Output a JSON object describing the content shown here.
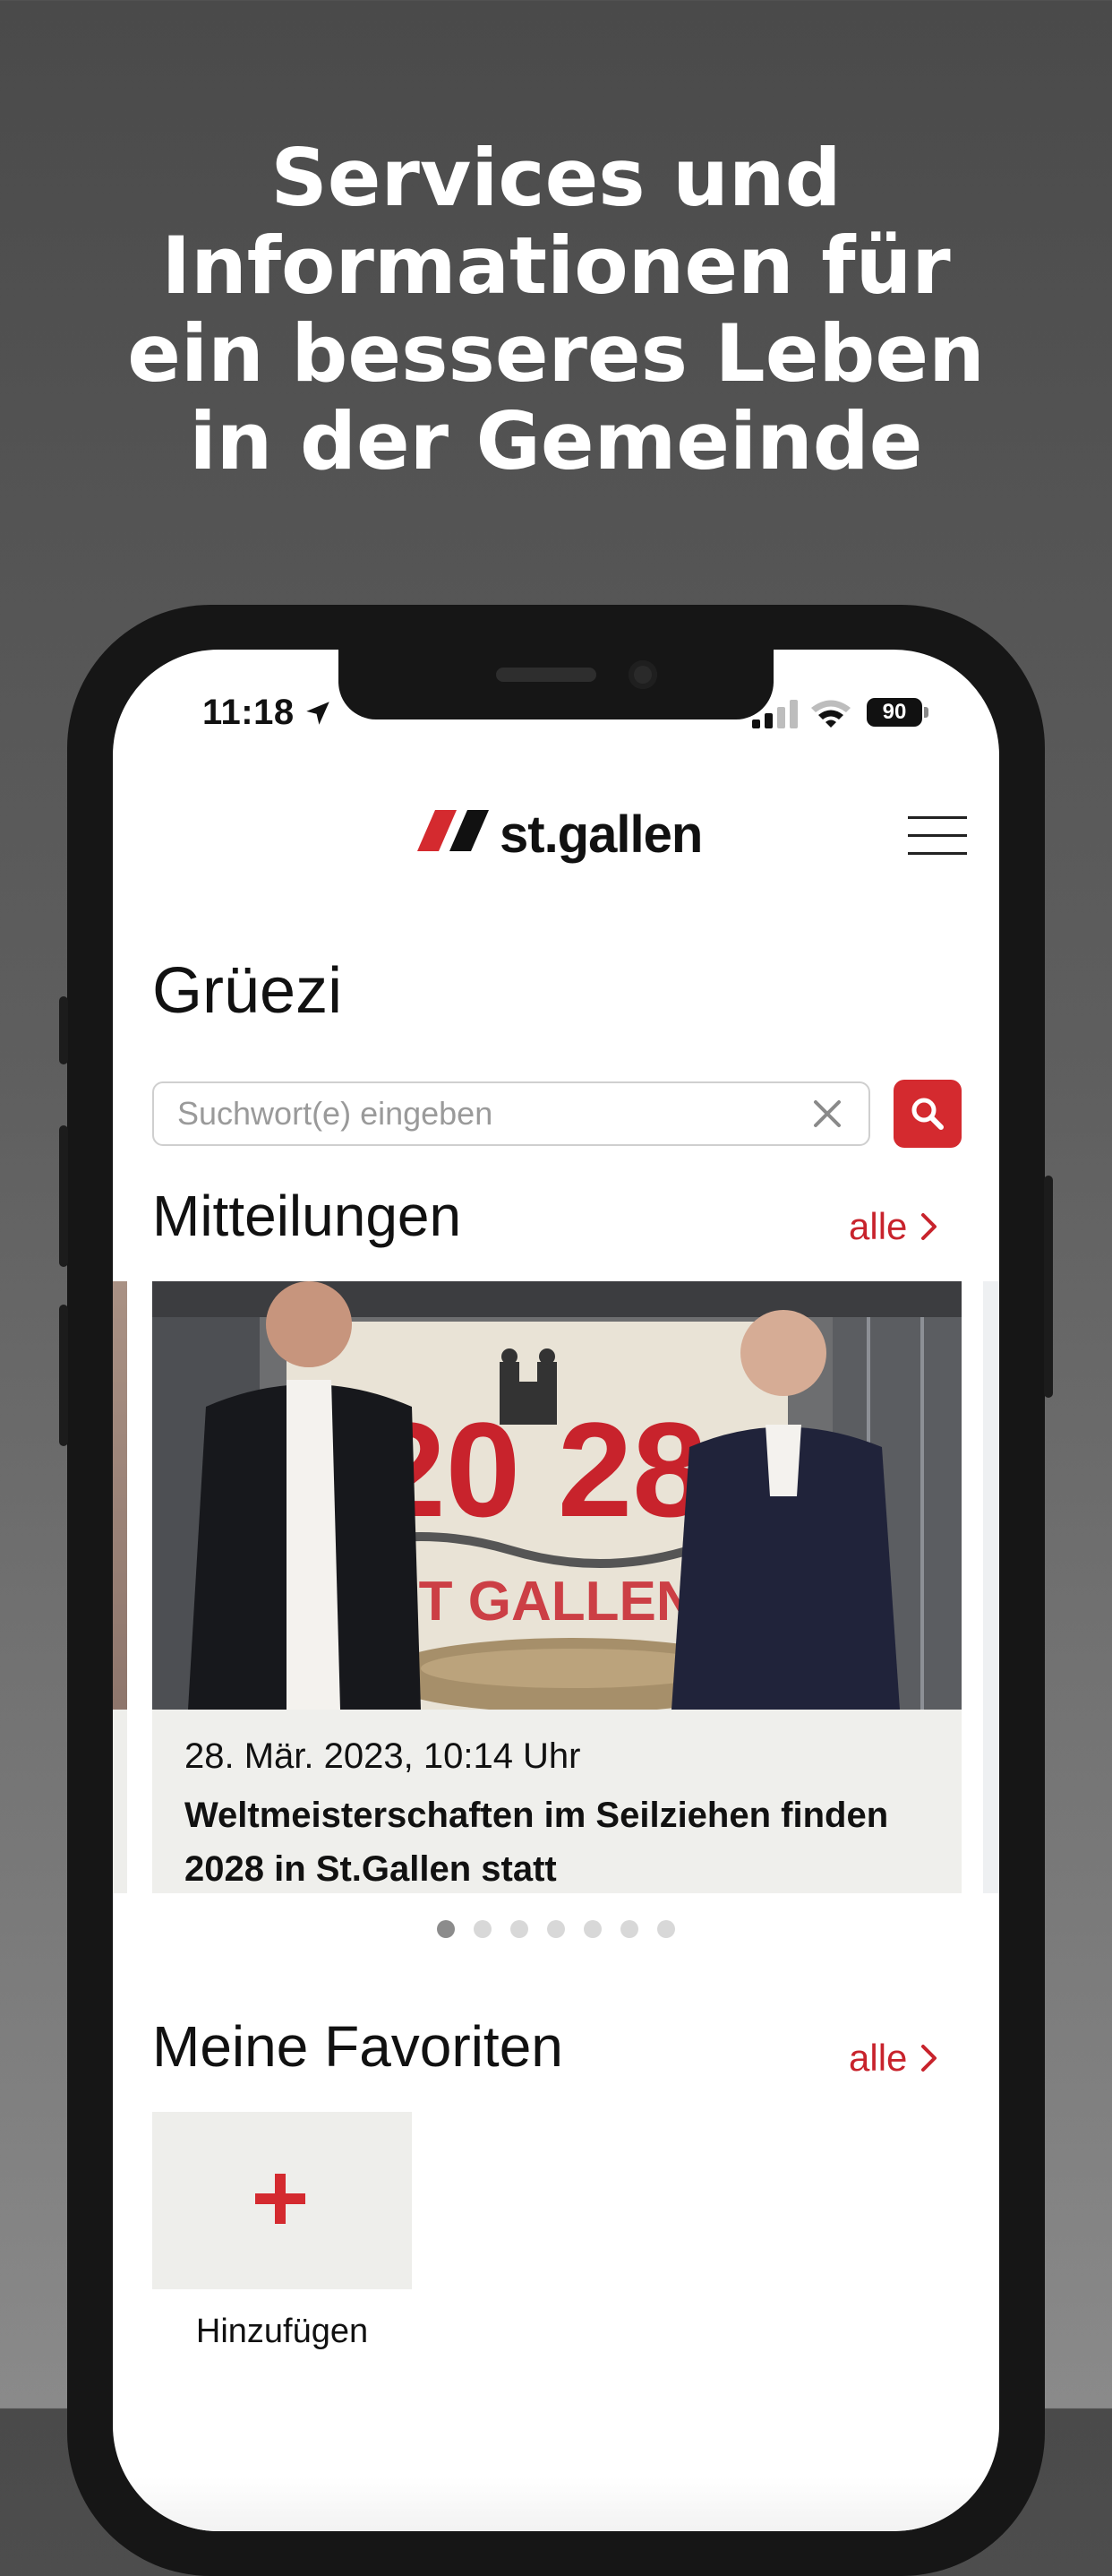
{
  "promo": {
    "headline_lines": [
      "Services und",
      "Informationen für",
      "ein besseres Leben",
      "in der Gemeinde"
    ]
  },
  "status_bar": {
    "time": "11:18",
    "battery": "90",
    "icons": [
      "location-arrow-icon",
      "signal-icon",
      "wifi-icon",
      "battery-icon"
    ]
  },
  "header": {
    "logo_text": "st.gallen",
    "menu_icon": "hamburger-menu-icon"
  },
  "greeting": "Grüezi",
  "search": {
    "placeholder": "Suchwort(e) eingeben",
    "value": ""
  },
  "news": {
    "title": "Mitteilungen",
    "all_label": "alle",
    "items": [
      {
        "date": "28. Mär. 2023, 10:14 Uhr",
        "title": "Weltmeisterschaften im Seilziehen finden 2028 in St.Gallen statt",
        "image_text": "20 28"
      }
    ],
    "page_count": 7,
    "active_page": 0
  },
  "favorites": {
    "title": "Meine Favoriten",
    "all_label": "alle",
    "add_label": "Hinzufügen"
  },
  "colors": {
    "accent": "#d42a2f",
    "link": "#c8232c",
    "background_top": "#4a4a4a",
    "tile": "#eeeeeb"
  }
}
